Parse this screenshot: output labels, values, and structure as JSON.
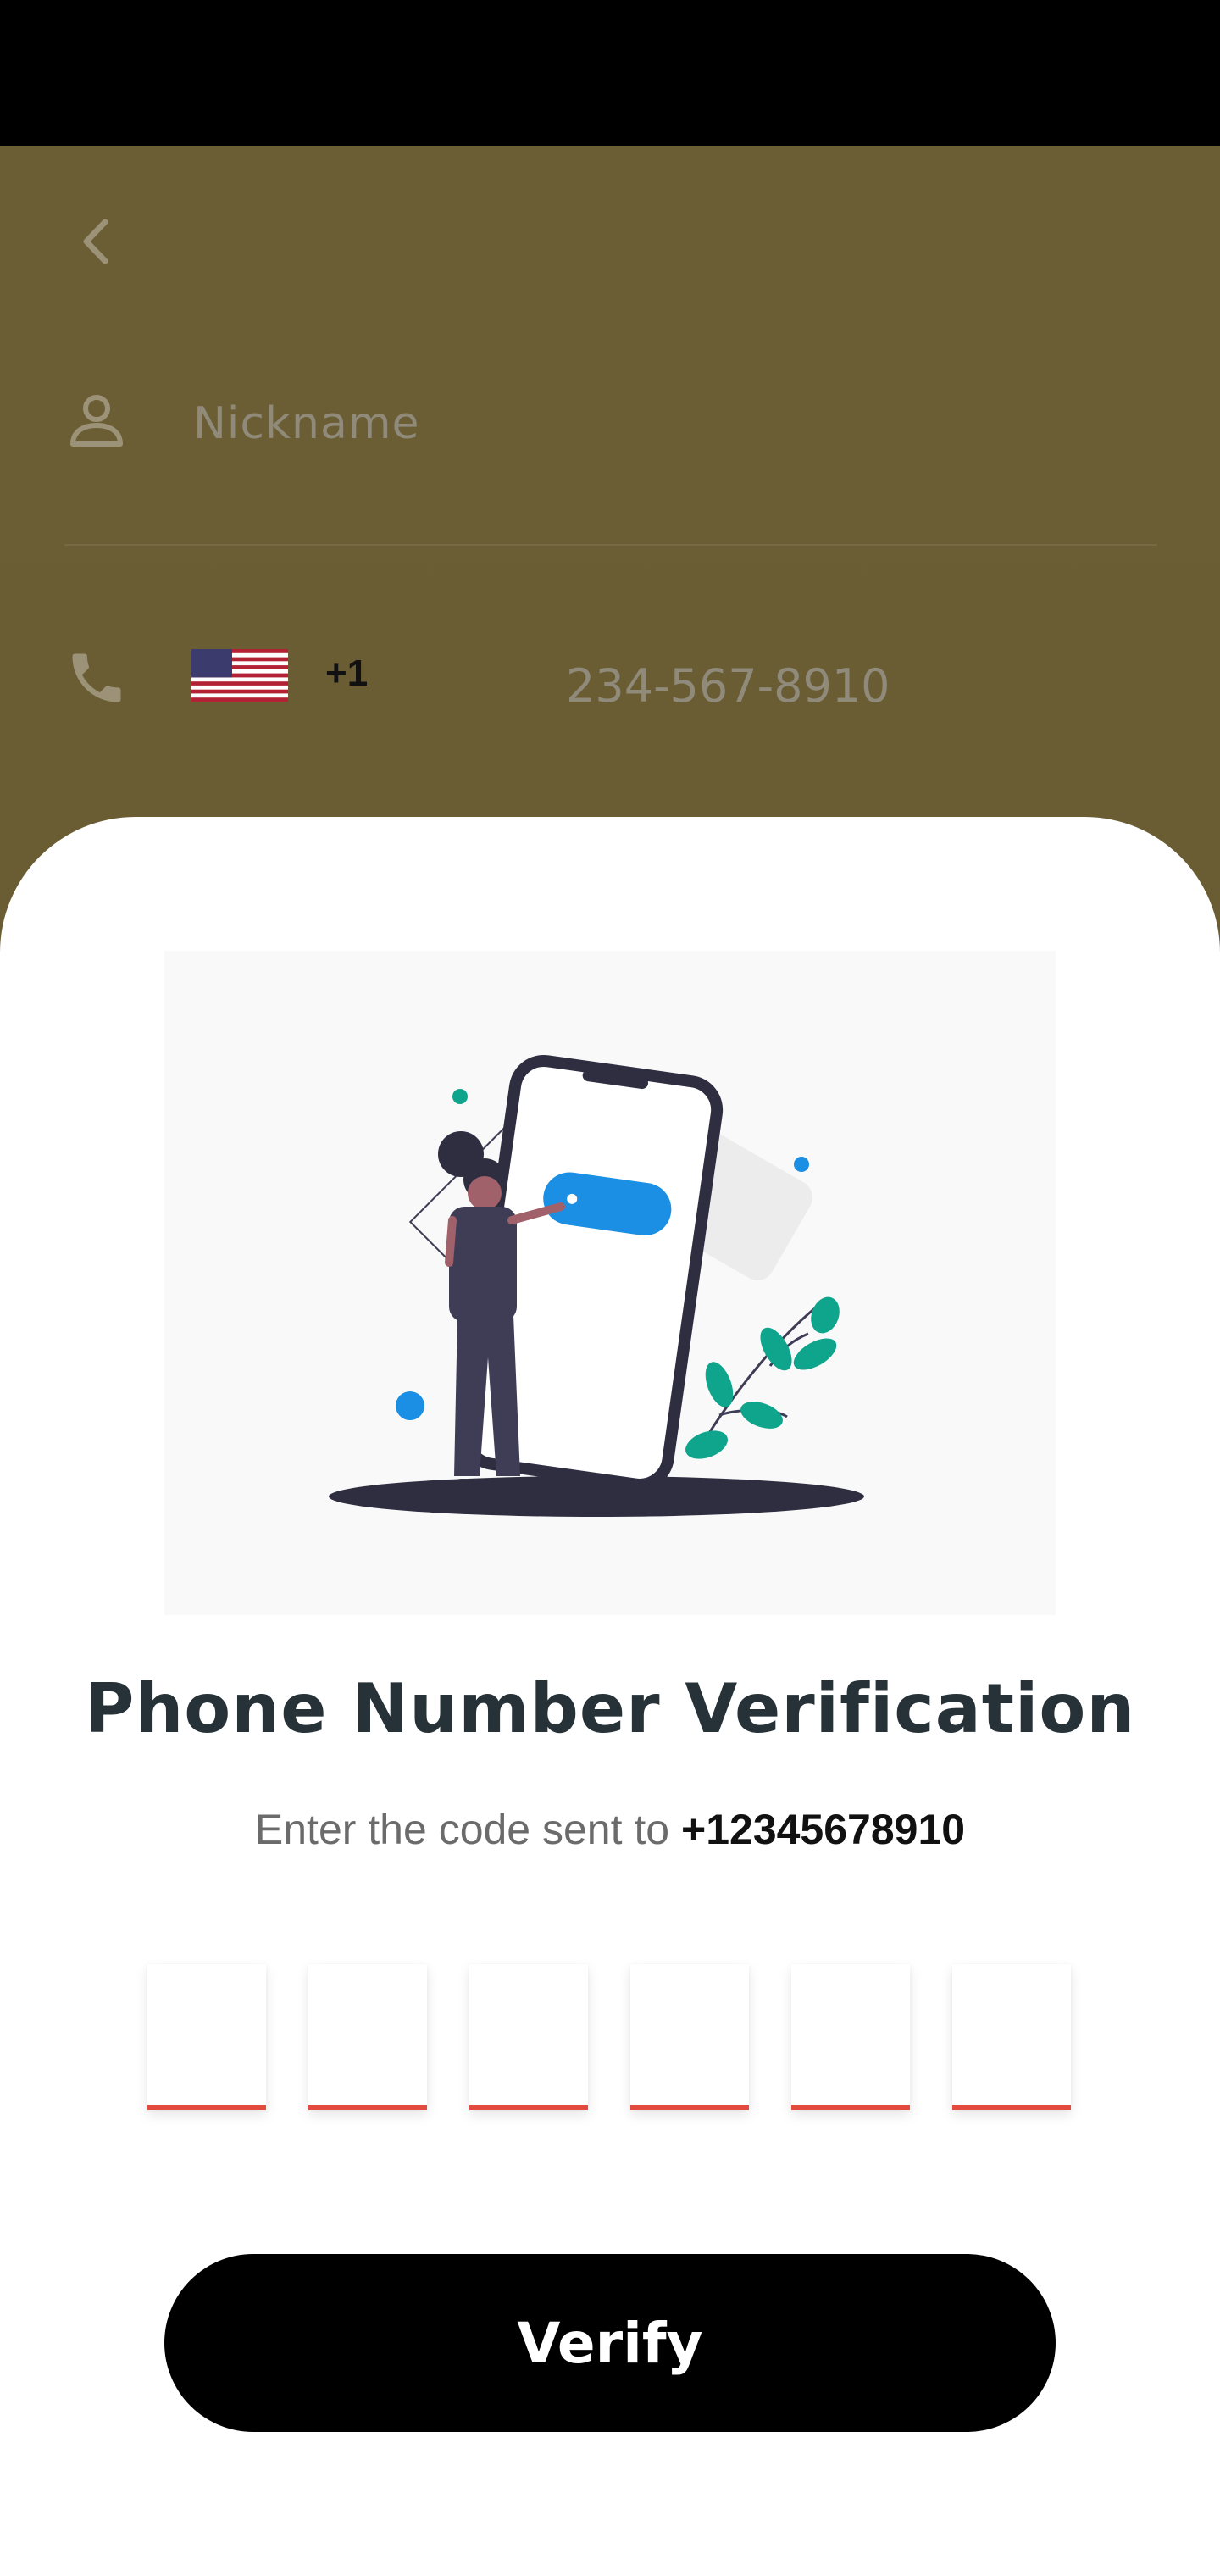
{
  "form": {
    "nickname_placeholder": "Nickname",
    "country_code": "+1",
    "phone_placeholder": "234-567-8910",
    "flag_icon": "us-flag-icon"
  },
  "dialog": {
    "title": "Phone Number Verification",
    "subtitle_prefix": "Enter the code sent to ",
    "phone_number": "+12345678910",
    "otp_digits": [
      "",
      "",
      "",
      "",
      "",
      ""
    ],
    "verify_label": "Verify"
  },
  "colors": {
    "background": "#6a5c33",
    "accent_blue": "#1a8fe3",
    "accent_green": "#0fa58c",
    "otp_underline": "#e34b3f",
    "title": "#263238"
  }
}
